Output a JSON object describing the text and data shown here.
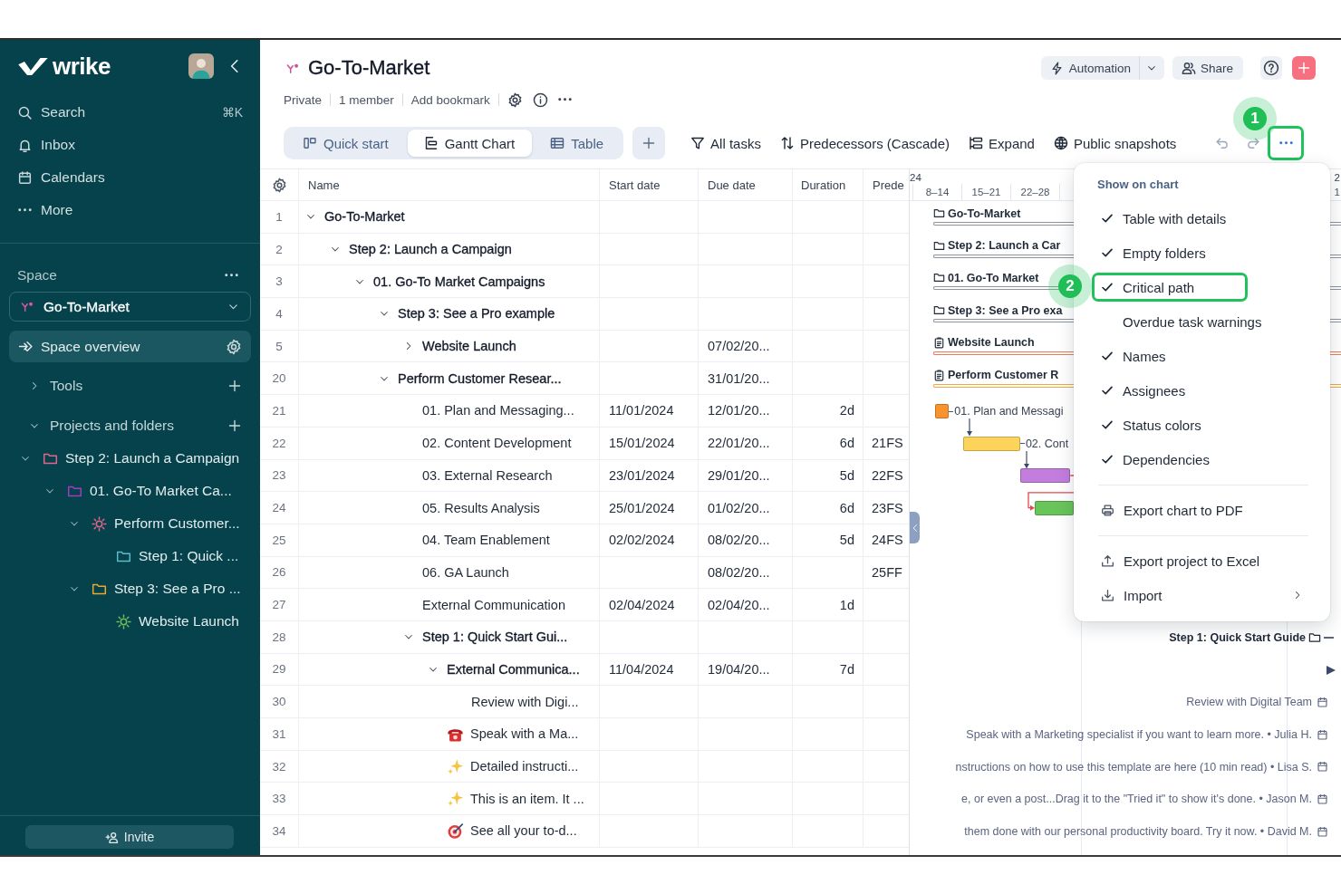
{
  "sidebar": {
    "brand": "wrike",
    "nav": [
      {
        "label": "Search",
        "shortcut": "⌘K"
      },
      {
        "label": "Inbox"
      },
      {
        "label": "Calendars"
      },
      {
        "label": "More"
      }
    ],
    "space_title": "Space",
    "space": {
      "label": "Go-To-Market"
    },
    "sections": [
      {
        "kind": "link",
        "label": "Space overview",
        "selected": true
      },
      {
        "kind": "group",
        "label": "Tools",
        "expanded": false,
        "selected": false
      },
      {
        "kind": "group",
        "label": "Projects and folders",
        "expanded": true,
        "selected": false
      }
    ],
    "tree": [
      {
        "label": "Step 2: Launch a Campaign",
        "kind": "folder",
        "color": "#e3668a",
        "expanded": true,
        "children": [
          {
            "label": "01. Go-To Market Ca...",
            "kind": "folder",
            "color": "#a53bbf",
            "expanded": true,
            "children": [
              {
                "label": "Perform Customer...",
                "kind": "project",
                "color": "#e3668a",
                "expanded": true,
                "children": [
                  {
                    "label": "Step 1: Quick ...",
                    "kind": "folder",
                    "color": "#5bbdc9"
                  }
                ]
              },
              {
                "label": "Step 3: See a Pro ...",
                "kind": "folder",
                "color": "#e8a92e",
                "expanded": true,
                "children": [
                  {
                    "label": "Website Launch",
                    "kind": "project",
                    "color": "#6cbf5a"
                  }
                ]
              }
            ]
          }
        ]
      }
    ],
    "invite": "Invite"
  },
  "header": {
    "title": "Go-To-Market",
    "meta": [
      "Private",
      "1 member",
      "Add bookmark"
    ],
    "automation": "Automation",
    "share": "Share"
  },
  "views": [
    {
      "label": "Quick start",
      "selected": false
    },
    {
      "label": "Gantt Chart",
      "selected": true
    },
    {
      "label": "Table",
      "selected": false
    }
  ],
  "toolbar": {
    "filters": [
      "All tasks",
      "Predecessors (Cascade)",
      "Expand",
      "Public snapshots"
    ],
    "history": [
      {
        "kind": "undo",
        "disabled": true
      },
      {
        "kind": "redo",
        "disabled": true
      }
    ],
    "more": {
      "highlighted": true,
      "step": "1"
    }
  },
  "table": {
    "columns": [
      "Name",
      "Start date",
      "Due date",
      "Duration",
      "Prede"
    ],
    "rows": [
      {
        "number": "1",
        "name": "Go-To-Market",
        "kind": "folder",
        "expanded": true,
        "chart": {
          "kind": "summary",
          "label": "Go-To-Market",
          "color": "#8f949c"
        },
        "children": [
          {
            "number": "2",
            "name": "Step 2: Launch a Campaign",
            "kind": "folder",
            "expanded": true,
            "chart": {
              "kind": "summary",
              "label": "Step 2: Launch a Car",
              "color": "#8f949c"
            },
            "children": [
              {
                "number": "3",
                "name": "01. Go-To Market Campaigns",
                "kind": "folder",
                "expanded": true,
                "chart": {
                  "kind": "summary",
                  "label": "01. Go-To Market",
                  "color": "#8f949c"
                },
                "children": [
                  {
                    "number": "4",
                    "name": "Step 3: See a Pro example",
                    "kind": "folder",
                    "expanded": true,
                    "chart": {
                      "kind": "summary",
                      "label": "Step 3: See a Pro exa",
                      "color": "#8f949c"
                    },
                    "children": [
                      {
                        "number": "5",
                        "name": "Website Launch",
                        "kind": "project",
                        "expanded": false,
                        "due": "07/02/20...",
                        "chart": {
                          "kind": "summary",
                          "label": "Website Launch",
                          "color": "#ee7b55"
                        }
                      }
                    ]
                  },
                  {
                    "number": "20",
                    "name": "Perform Customer Resear...",
                    "kind": "project",
                    "expanded": true,
                    "due": "31/01/20...",
                    "chart": {
                      "kind": "summary",
                      "label": "Perform Customer R",
                      "color": "#f0a93e"
                    },
                    "children": [
                      {
                        "number": "21",
                        "name": "01. Plan and Messaging...",
                        "kind": "task",
                        "start": "11/01/2024",
                        "due": "12/01/20...",
                        "duration": "2d",
                        "chart": {
                          "kind": "bar",
                          "label": "01. Plan and Messagi",
                          "color": "#f7942f"
                        }
                      },
                      {
                        "number": "22",
                        "name": "02. Content Development",
                        "kind": "task",
                        "start": "15/01/2024",
                        "due": "22/01/20...",
                        "duration": "6d",
                        "predecessors": "21FS",
                        "chart": {
                          "kind": "bar",
                          "label": "02. Cont",
                          "color": "#fcd45c",
                          "critical": false
                        }
                      },
                      {
                        "number": "23",
                        "name": "03. External Research",
                        "kind": "task",
                        "start": "23/01/2024",
                        "due": "29/01/20...",
                        "duration": "5d",
                        "predecessors": "22FS",
                        "chart": {
                          "kind": "bar",
                          "color": "#c27ddd",
                          "critical": false
                        }
                      },
                      {
                        "number": "24",
                        "name": "05. Results Analysis",
                        "kind": "task",
                        "start": "25/01/2024",
                        "due": "01/02/20...",
                        "duration": "6d",
                        "predecessors": "23FS",
                        "chart": {
                          "kind": "bar",
                          "color": "#69c45a",
                          "critical": true
                        }
                      },
                      {
                        "number": "25",
                        "name": "04. Team Enablement",
                        "kind": "task",
                        "start": "02/02/2024",
                        "due": "08/02/20...",
                        "duration": "5d",
                        "predecessors": "24FS"
                      },
                      {
                        "number": "26",
                        "name": "06. GA Launch",
                        "kind": "task",
                        "due": "08/02/20...",
                        "predecessors": "25FF"
                      },
                      {
                        "number": "27",
                        "name": "External Communication",
                        "kind": "task",
                        "start": "02/04/2024",
                        "due": "02/04/20...",
                        "duration": "1d"
                      },
                      {
                        "number": "28",
                        "name": "Step 1: Quick Start Gui...",
                        "kind": "folder",
                        "expanded": true,
                        "chart": {
                          "kind": "note",
                          "label": "Step 1: Quick Start Guide"
                        },
                        "children": [
                          {
                            "number": "29",
                            "name": "External Communica...",
                            "expanded": true,
                            "start": "11/04/2024",
                            "due": "19/04/20...",
                            "duration": "7d",
                            "chart": {
                              "kind": "offscreen"
                            },
                            "children": [
                              {
                                "number": "30",
                                "name": "Review with Digi...",
                                "kind": "task",
                                "chart": {
                                  "kind": "note",
                                  "label": "Review with Digital Team"
                                }
                              },
                              {
                                "number": "31",
                                "name": "Speak with a Ma...",
                                "kind": "task",
                                "chart": {
                                  "kind": "note",
                                  "label": "Speak with a Marketing specialist if you want to learn more. • Julia H."
                                }
                              },
                              {
                                "number": "32",
                                "name": "Detailed instructi...",
                                "kind": "task",
                                "chart": {
                                  "kind": "note",
                                  "label": "nstructions on how to use this template are here (10 min read) • Lisa S."
                                }
                              },
                              {
                                "number": "33",
                                "name": "This is an item. It ...",
                                "kind": "task",
                                "chart": {
                                  "kind": "note",
                                  "label": "e, or even a post...Drag it to the \"Tried it\" to show it's done. • Jason M."
                                }
                              },
                              {
                                "number": "34",
                                "name": "See all your to-d...",
                                "kind": "task",
                                "chart": {
                                  "kind": "note",
                                  "label": "them done with our personal productivity board. Try it now. • David M."
                                }
                              }
                            ]
                          }
                        ]
                      }
                    ]
                  }
                ]
              }
            ]
          }
        ]
      }
    ]
  },
  "gantt": {
    "month": "24",
    "weeks": [
      "8–14",
      "15–21",
      "22–28"
    ],
    "edge_month": "2",
    "edge_week": "1"
  },
  "menu": {
    "title": "Show on chart",
    "items": [
      {
        "kind": "check",
        "label": "Table with details",
        "checked": true,
        "highlighted": false
      },
      {
        "kind": "check",
        "label": "Empty folders",
        "checked": true,
        "highlighted": false
      },
      {
        "kind": "check",
        "label": "Critical path",
        "checked": true,
        "highlighted": true,
        "step": "2"
      },
      {
        "kind": "check",
        "label": "Overdue task warnings",
        "checked": false,
        "highlighted": false
      },
      {
        "kind": "check",
        "label": "Names",
        "checked": true,
        "highlighted": false
      },
      {
        "kind": "check",
        "label": "Assignees",
        "checked": true,
        "highlighted": false
      },
      {
        "kind": "check",
        "label": "Status colors",
        "checked": true,
        "highlighted": false
      },
      {
        "kind": "check",
        "label": "Dependencies",
        "checked": true,
        "highlighted": false
      },
      {
        "kind": "divider"
      },
      {
        "kind": "action",
        "label": "Export chart to PDF"
      },
      {
        "kind": "divider"
      },
      {
        "kind": "action",
        "label": "Export project to Excel"
      },
      {
        "kind": "submenu",
        "label": "Import"
      }
    ]
  }
}
